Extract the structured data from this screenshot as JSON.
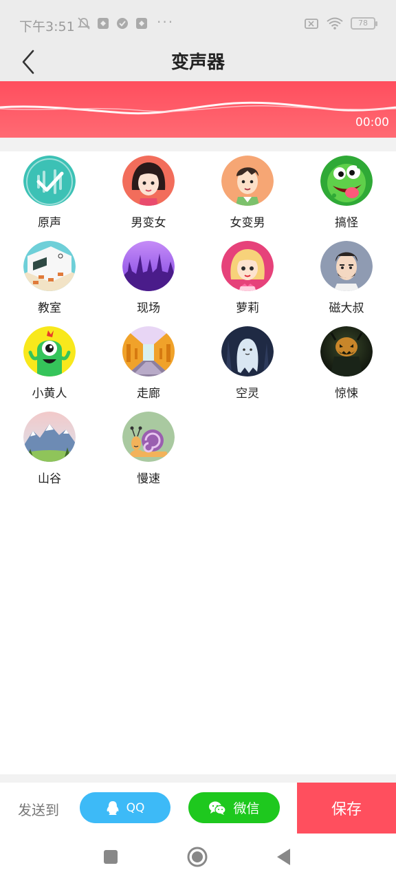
{
  "status_bar": {
    "time": "下午3:51",
    "more": "···",
    "battery": "78"
  },
  "header": {
    "title": "变声器"
  },
  "player": {
    "time": "00:00"
  },
  "effects": [
    {
      "label": "原声",
      "icon": "original-voice-icon"
    },
    {
      "label": "男变女",
      "icon": "woman-face-icon"
    },
    {
      "label": "女变男",
      "icon": "man-face-icon"
    },
    {
      "label": "搞怪",
      "icon": "green-monster-icon"
    },
    {
      "label": "教室",
      "icon": "classroom-icon"
    },
    {
      "label": "现场",
      "icon": "concert-crowd-icon"
    },
    {
      "label": "萝莉",
      "icon": "loli-girl-icon"
    },
    {
      "label": "磁大叔",
      "icon": "bearded-uncle-icon"
    },
    {
      "label": "小黄人",
      "icon": "yellow-minion-icon"
    },
    {
      "label": "走廊",
      "icon": "corridor-icon"
    },
    {
      "label": "空灵",
      "icon": "ghost-icon"
    },
    {
      "label": "惊悚",
      "icon": "horror-pumpkin-icon"
    },
    {
      "label": "山谷",
      "icon": "valley-mountain-icon"
    },
    {
      "label": "慢速",
      "icon": "snail-icon"
    }
  ],
  "share": {
    "send_label": "发送到",
    "qq_label": "QQ",
    "wechat_label": "微信",
    "save_label": "保存"
  },
  "colors": {
    "accent": "#ff4f5e",
    "qq": "#3dbaf7",
    "wechat": "#1ec81e"
  }
}
